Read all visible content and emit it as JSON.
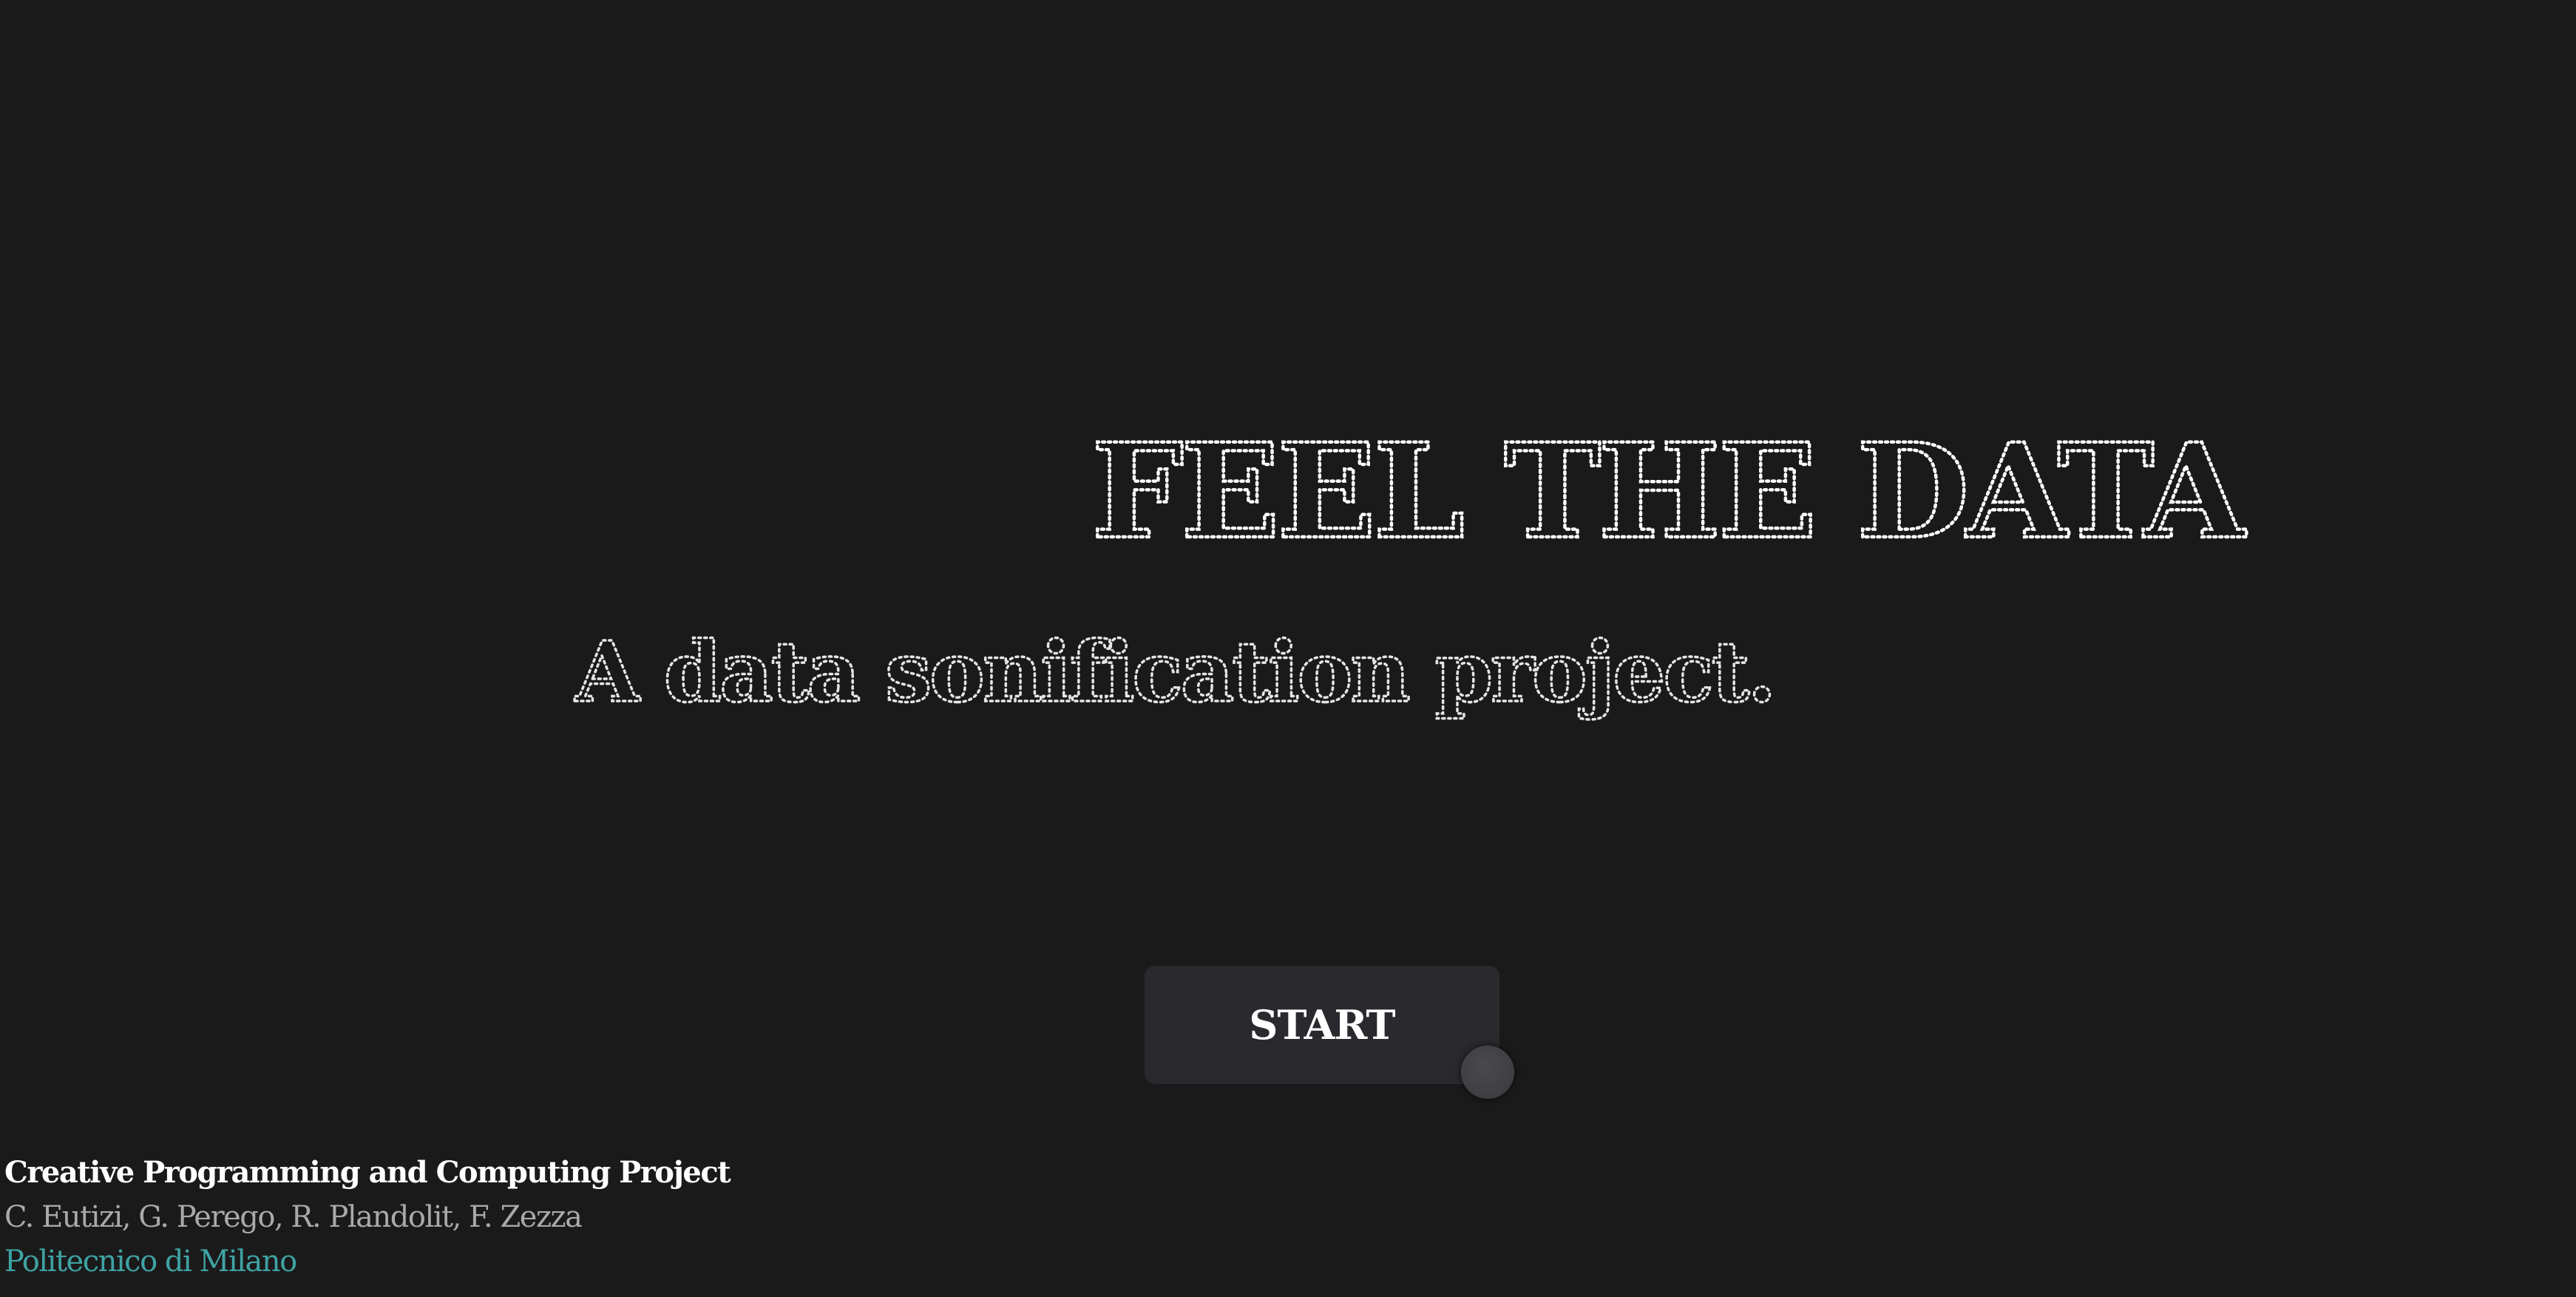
{
  "hero": {
    "title": "FEEL THE DATA",
    "subtitle": "A data sonification project."
  },
  "start_button": {
    "label": "START"
  },
  "footer": {
    "course": "Creative Programming and Computing Project",
    "authors": "C. Eutizi, G. Perego, R. Plandolit, F. Zezza",
    "university": "Politecnico di Milano"
  },
  "colors": {
    "background": "#1b1a1b",
    "button": "#29292e",
    "accent": "#3fa3a3"
  }
}
